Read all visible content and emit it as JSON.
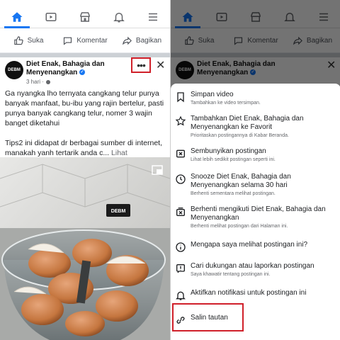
{
  "actions": {
    "like": "Suka",
    "comment": "Komentar",
    "share": "Bagikan"
  },
  "post": {
    "page_name": "Diet Enak, Bahagia dan Menyenangkan",
    "time": "3 hari ·",
    "paragraph1": "Ga nyangka lho ternyata cangkang telur punya banyak manfaat,  bu-ibu yang rajin bertelur,  pasti punya banyak cangkang telur, nomer 3 wajin banget diketahui",
    "paragraph2": "Tips2 ini didapat dr berbagai sumber di internet, manakah yanh tertarik anda c...",
    "see_more": "Lihat Selengkapnya",
    "photo_label": "DEBM",
    "avatar_label": "DEBM"
  },
  "menu": {
    "items": [
      {
        "title": "Simpan video",
        "sub": "Tambahkan ke video tersimpan.",
        "icon": "bookmark-icon"
      },
      {
        "title": "Tambahkan Diet Enak, Bahagia dan Menyenangkan ke Favorit",
        "sub": "Prioritaskan postingannya di Kabar Beranda.",
        "icon": "star-icon"
      },
      {
        "title": "Sembunyikan postingan",
        "sub": "Lihat lebih sedikit postingan seperti ini.",
        "icon": "hide-icon"
      },
      {
        "title": "Snooze Diet Enak, Bahagia dan Menyenangkan selama 30 hari",
        "sub": "Berhenti sementara melihat postingan.",
        "icon": "clock-icon"
      },
      {
        "title": "Berhenti mengikuti Diet Enak, Bahagia dan Menyenangkan",
        "sub": "Berhenti melihat postingan dari Halaman ini.",
        "icon": "unfollow-icon"
      },
      {
        "title": "Mengapa saya melihat postingan ini?",
        "sub": "",
        "icon": "info-icon"
      },
      {
        "title": "Cari dukungan atau laporkan postingan",
        "sub": "Saya khawatir tentang postingan ini.",
        "icon": "report-icon"
      },
      {
        "title": "Aktifkan notifikasi untuk postingan ini",
        "sub": "",
        "icon": "bell-icon"
      },
      {
        "title": "Salin tautan",
        "sub": "",
        "icon": "link-icon"
      }
    ]
  },
  "colors": {
    "accent": "#1877f2",
    "highlight_box": "#d0202a"
  }
}
